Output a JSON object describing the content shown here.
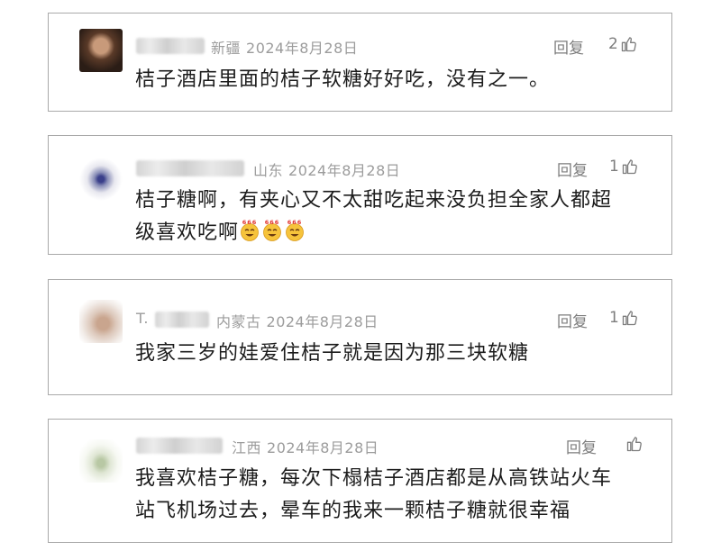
{
  "comments": [
    {
      "location": "新疆",
      "date": "2024年8月28日",
      "reply_label": "回复",
      "like_count": "2",
      "content": "桔子酒店里面的桔子软糖好好吃，没有之一。"
    },
    {
      "location": "山东",
      "date": "2024年8月28日",
      "reply_label": "回复",
      "like_count": "1",
      "content_line1": "桔子糖啊，有夹心又不太甜吃起来没负担全家人都超",
      "content_line2": "级喜欢吃啊",
      "emoji_label": "666"
    },
    {
      "name_visible": "T.",
      "location": "内蒙古",
      "date": "2024年8月28日",
      "reply_label": "回复",
      "like_count": "1",
      "content": "我家三岁的娃爱住桔子就是因为那三块软糖"
    },
    {
      "location": "江西",
      "date": "2024年8月28日",
      "reply_label": "回复",
      "like_count": "",
      "content_line1": "我喜欢桔子糖，每次下榻桔子酒店都是从高铁站火车",
      "content_line2": "站飞机场过去，晕车的我来一颗桔子糖就很幸福"
    }
  ],
  "colors": {
    "meta": "#9c9c9c",
    "content": "#1c1c1c",
    "border": "#a9a9a9",
    "emoji": "#f6c33b"
  },
  "icons": {
    "like": "thumbs-up-icon",
    "emoji": "grinning-face-666-emoji"
  }
}
